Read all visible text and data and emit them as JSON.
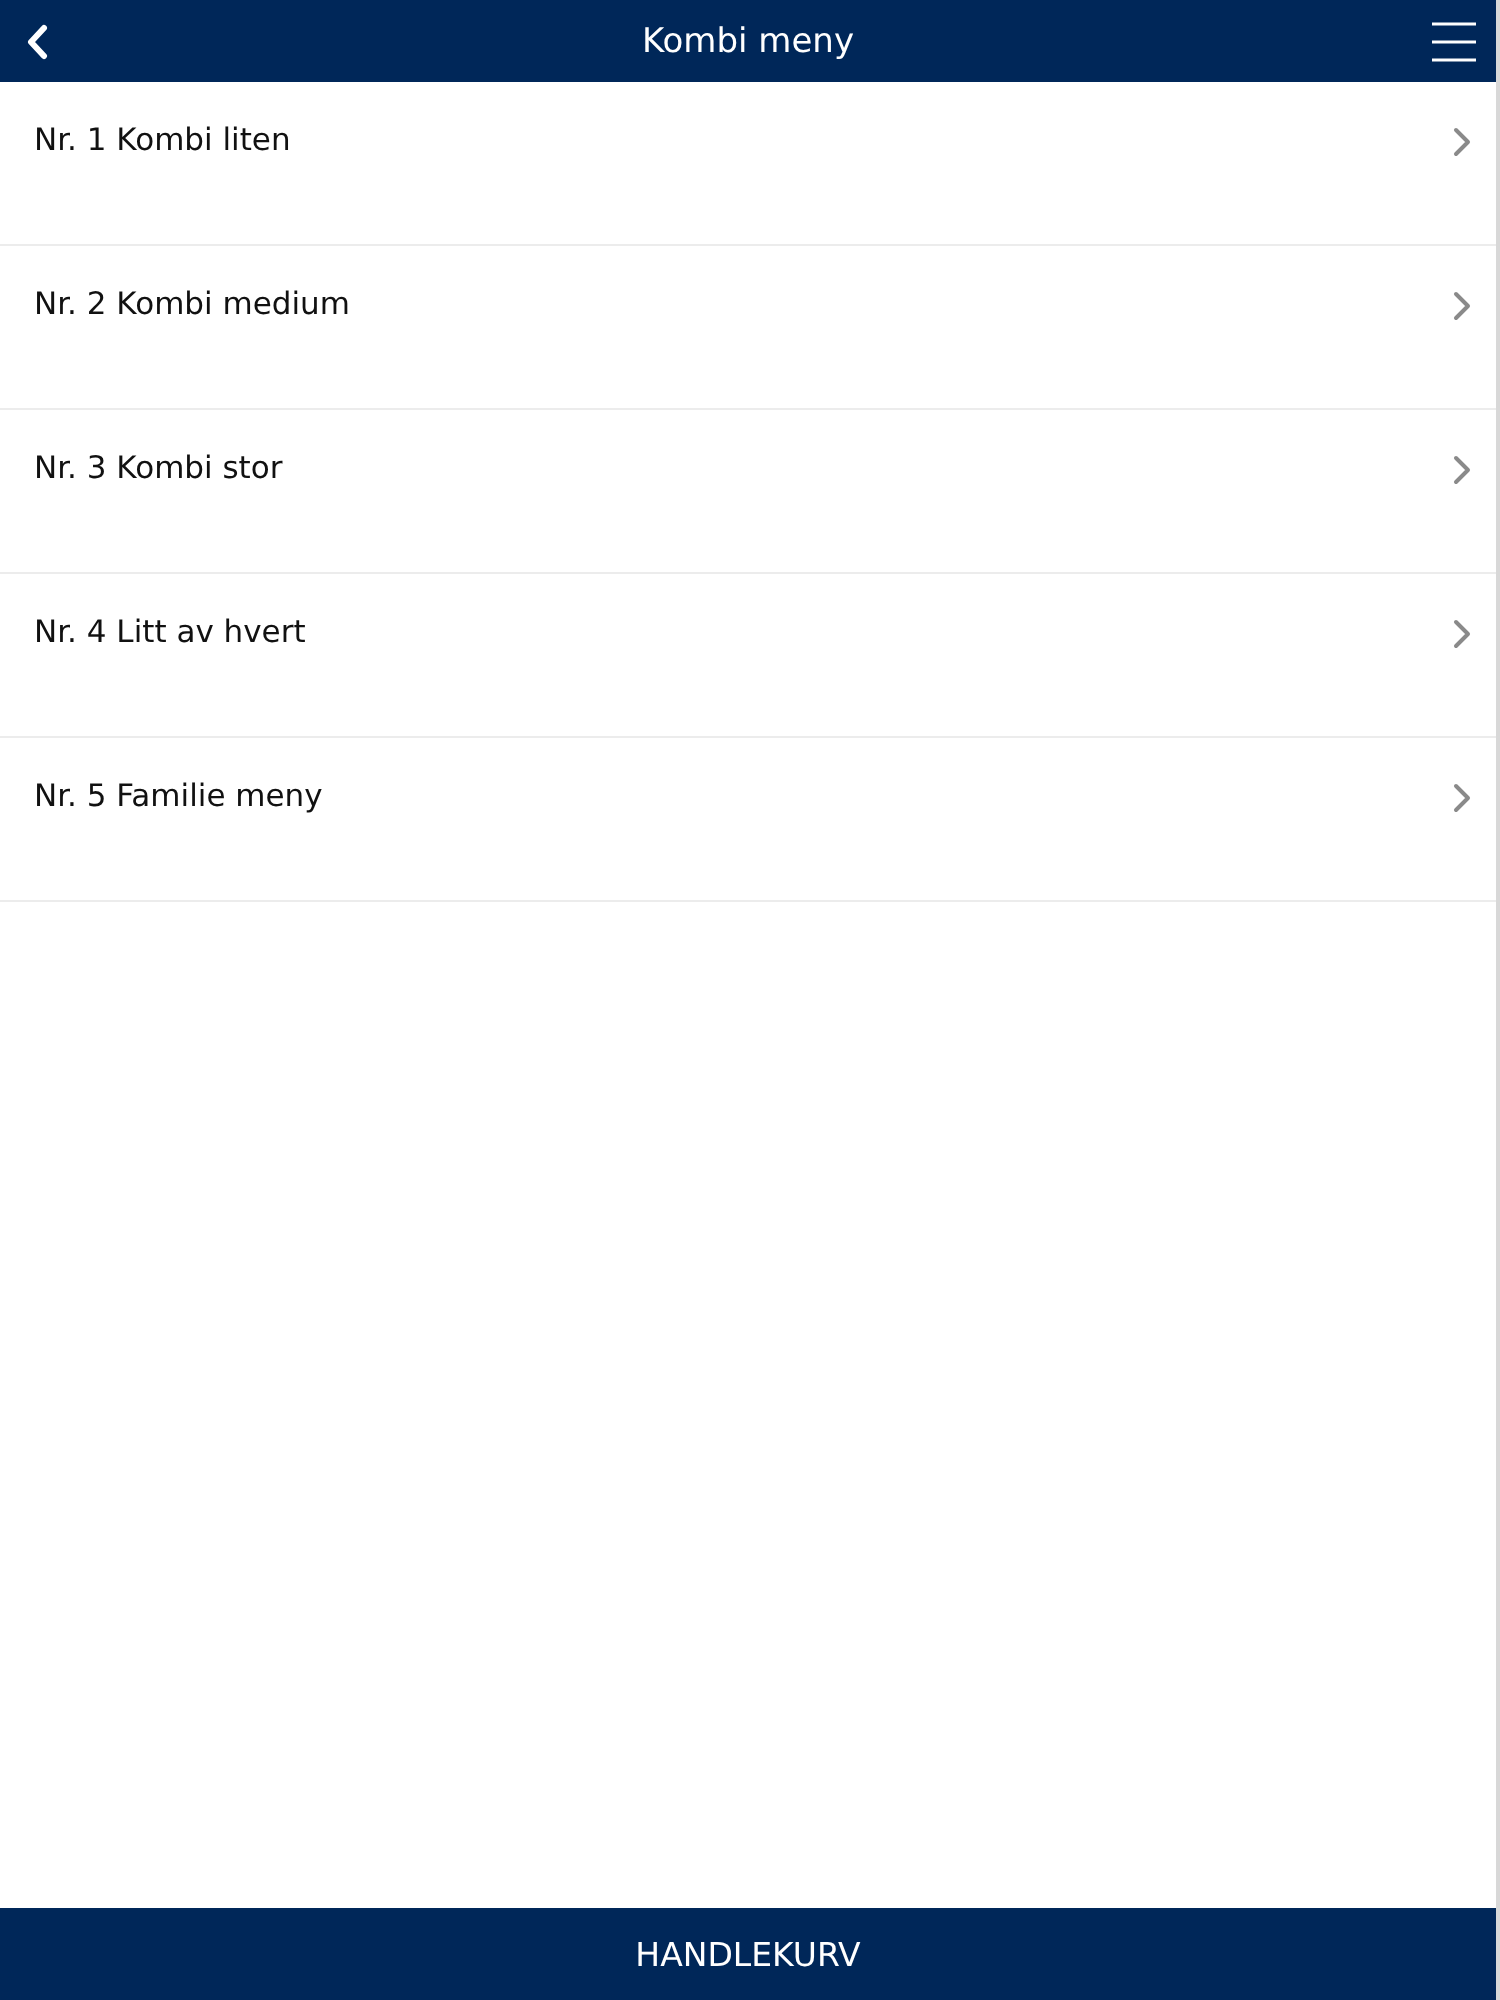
{
  "header": {
    "title": "Kombi meny"
  },
  "menu_items": [
    {
      "label": "Nr. 1 Kombi liten"
    },
    {
      "label": "Nr. 2 Kombi medium"
    },
    {
      "label": "Nr. 3 Kombi stor"
    },
    {
      "label": "Nr. 4 Litt av hvert"
    },
    {
      "label": "Nr. 5 Familie meny"
    }
  ],
  "footer": {
    "label": "HANDLEKURV"
  }
}
